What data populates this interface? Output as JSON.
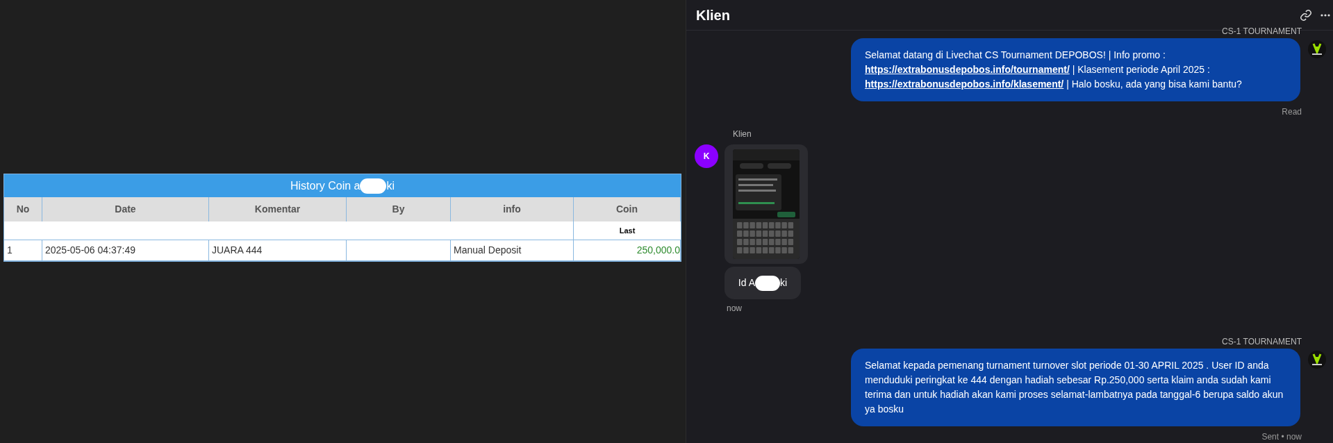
{
  "history_table": {
    "title_before": "History Coin a",
    "title_after": "ki",
    "columns": [
      "No",
      "Date",
      "Komentar",
      "By",
      "info",
      "Coin"
    ],
    "subheader": "Last",
    "rows": [
      {
        "cells": [
          "1",
          "2025-05-06 04:37:49",
          "JUARA 444",
          "",
          "Manual Deposit",
          "250,000.0"
        ]
      }
    ]
  },
  "chat": {
    "title": "Klien",
    "messages": [
      {
        "kind": "agent",
        "sender": "CS-1 TOURNAMENT",
        "segments": [
          {
            "kind": "text",
            "text": "Selamat datang di Livechat CS Tournament DEPOBOS! | Info promo : "
          },
          {
            "kind": "link",
            "text": "https://extrabonusdepobos.info/tournament/"
          },
          {
            "kind": "text",
            "text": " | Klasement periode April 2025 : "
          },
          {
            "kind": "link",
            "text": "https://extrabonusdepobos.info/klasement/"
          },
          {
            "kind": "text",
            "text": " | Halo bosku, ada yang bisa kami bantu?"
          }
        ],
        "status": "Read"
      },
      {
        "kind": "client",
        "sender": "Klien",
        "avatar": "K",
        "text_before": "Id A",
        "text_after": "ki",
        "time": "now"
      },
      {
        "kind": "agent",
        "sender": "CS-1 TOURNAMENT",
        "segments": [
          {
            "kind": "text",
            "text": "Selamat kepada pemenang turnament turnover slot periode 01-30 APRIL 2025 . User ID anda menduduki peringkat ke 444 dengan hadiah sebesar Rp.250,000 serta klaim anda sudah kami terima dan untuk hadiah akan kami proses selamat-lambatnya pada tanggal-6 berupa saldo akun ya bosku"
          }
        ],
        "status": "Sent • now"
      }
    ]
  }
}
